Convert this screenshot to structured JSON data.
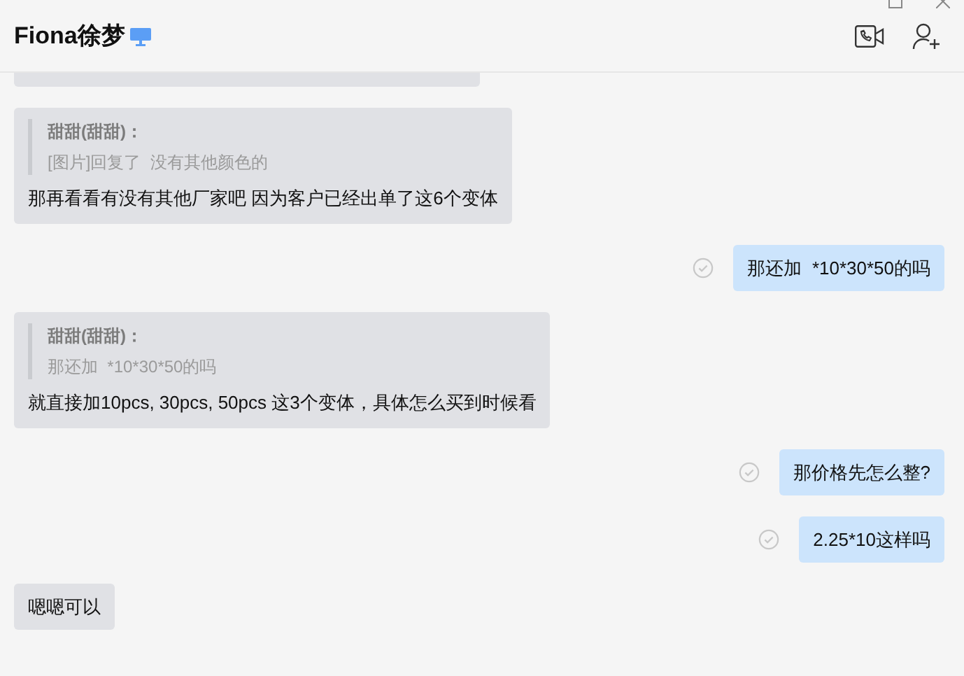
{
  "header": {
    "title": "Fiona徐梦",
    "online_device": true
  },
  "messages": [
    {
      "kind": "cut",
      "outgoing": false
    },
    {
      "kind": "quote",
      "outgoing": false,
      "quote_author": "甜甜(甜甜)：",
      "quote_text": "[图片]回复了  没有其他颜色的",
      "text": "那再看看有没有其他厂家吧 因为客户已经出单了这6个变体"
    },
    {
      "kind": "plain",
      "outgoing": true,
      "read": true,
      "text": "那还加  *10*30*50的吗"
    },
    {
      "kind": "quote",
      "outgoing": false,
      "quote_author": "甜甜(甜甜)：",
      "quote_text": "那还加  *10*30*50的吗",
      "text": "就直接加10pcs, 30pcs, 50pcs 这3个变体，具体怎么买到时候看"
    },
    {
      "kind": "plain",
      "outgoing": true,
      "read": true,
      "text": "那价格先怎么整?"
    },
    {
      "kind": "plain",
      "outgoing": true,
      "read": true,
      "text": "2.25*10这样吗"
    },
    {
      "kind": "plain",
      "outgoing": false,
      "text": "嗯嗯可以"
    }
  ]
}
